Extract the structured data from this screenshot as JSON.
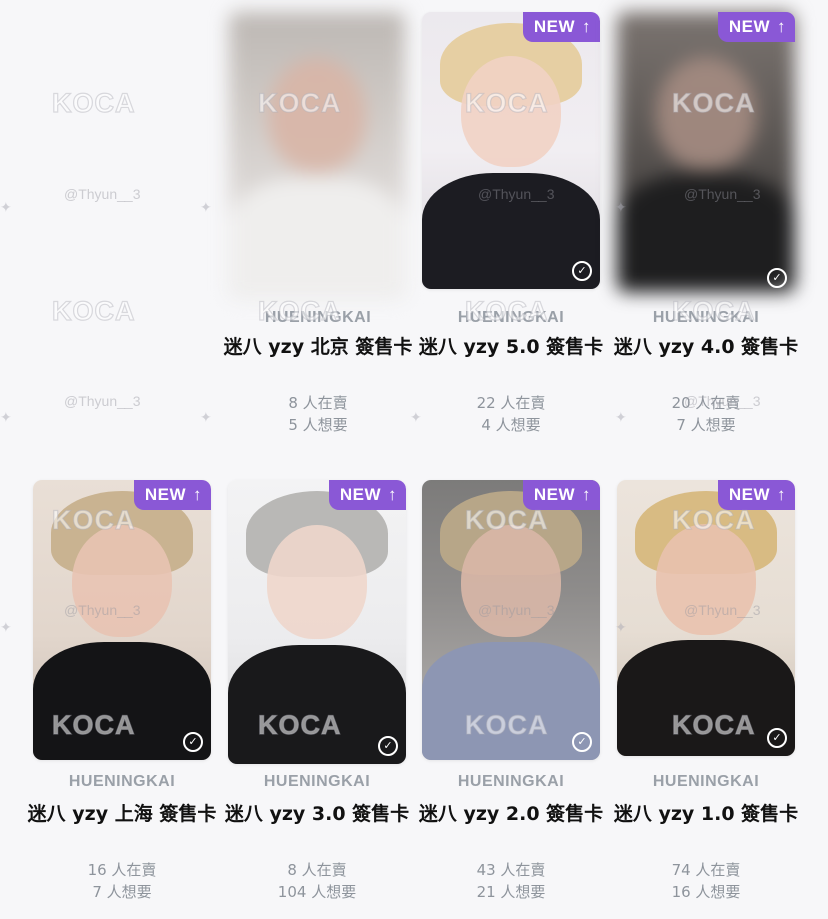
{
  "watermark": {
    "logo": "KOCA",
    "handle": "@Thyun__3"
  },
  "badge_label": "NEW",
  "cards": [
    {
      "artist": "HUENINGKAI",
      "title": "迷八 yzy 北京 簽售卡",
      "selling": "8 人在賣",
      "wanted": "5 人想要",
      "is_new": false
    },
    {
      "artist": "HUENINGKAI",
      "title": "迷八 yzy 5.0 簽售卡",
      "selling": "22 人在賣",
      "wanted": "4 人想要",
      "is_new": true
    },
    {
      "artist": "HUENINGKAI",
      "title": "迷八 yzy 4.0 簽售卡",
      "selling": "20 人在賣",
      "wanted": "7 人想要",
      "is_new": true
    },
    {
      "artist": "HUENINGKAI",
      "title": "迷八 yzy 上海 簽售卡",
      "selling": "16 人在賣",
      "wanted": "7 人想要",
      "is_new": true
    },
    {
      "artist": "HUENINGKAI",
      "title": "迷八 yzy 3.0 簽售卡",
      "selling": "8 人在賣",
      "wanted": "104 人想要",
      "is_new": true
    },
    {
      "artist": "HUENINGKAI",
      "title": "迷八 yzy 2.0 簽售卡",
      "selling": "43 人在賣",
      "wanted": "21 人想要",
      "is_new": true
    },
    {
      "artist": "HUENINGKAI",
      "title": "迷八 yzy 1.0 簽售卡",
      "selling": "74 人在賣",
      "wanted": "16 人想要",
      "is_new": true
    }
  ],
  "colors": {
    "badge": "#8a58d6",
    "artist_text": "#9aa0a8",
    "title_text": "#111111",
    "stat_text": "#8e949c"
  }
}
